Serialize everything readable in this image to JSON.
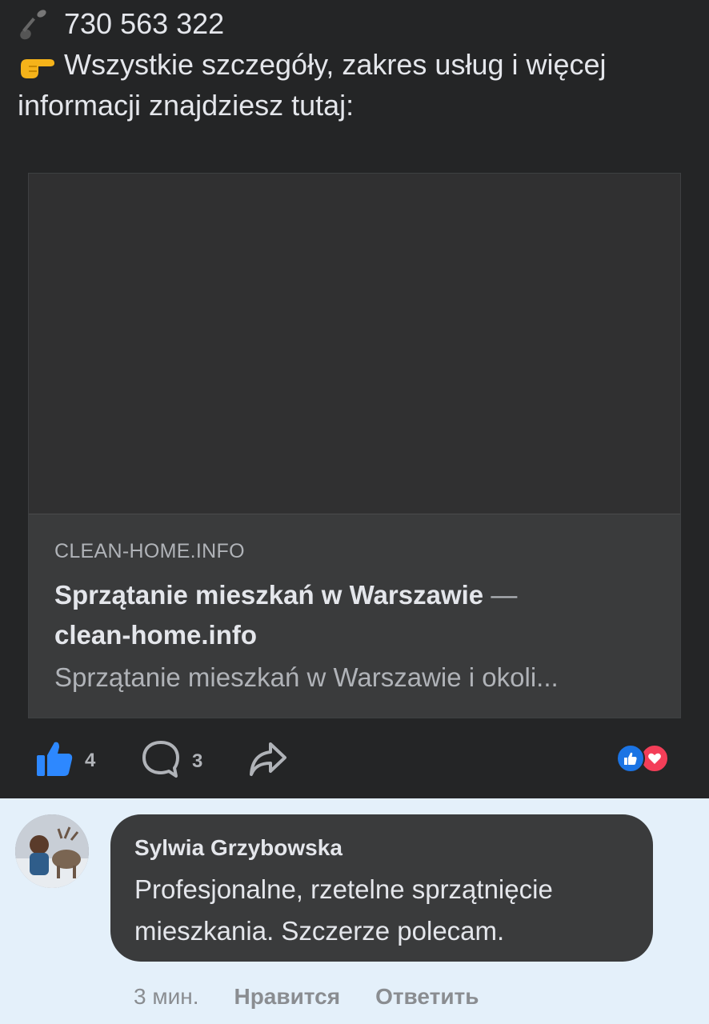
{
  "post": {
    "phone_icon": "telephone-receiver-icon",
    "phone": "730 563 322",
    "pointer_icon": "backhand-index-pointing-right-icon",
    "text_line1": "Wszystkie szczegóły, zakres usług i więcej",
    "text_line2": "informacji znajdziesz tutaj:"
  },
  "link_card": {
    "domain": "CLEAN-HOME.INFO",
    "title_part1": "Sprzątanie mieszkań w Warszawie",
    "title_dash": "—",
    "title_part2": "clean-home.info",
    "description": "Sprzątanie mieszkań w Warszawie i okoli..."
  },
  "actions": {
    "like_count": "4",
    "comment_count": "3",
    "reactions": [
      "like-icon",
      "heart-icon"
    ]
  },
  "comment": {
    "author": "Sylwia Grzybowska",
    "text_line1": "Profesjonalne, rzetelne sprzątnięcie",
    "text_line2": "mieszkania. Szczerze polecam.",
    "time": "3 мин.",
    "like_label": "Нравится",
    "reply_label": "Ответить"
  },
  "colors": {
    "background": "#242526",
    "card": "#3a3b3c",
    "accent_blue": "#1b74e4",
    "heart_red": "#f33e58",
    "comment_area": "#e4f0fa"
  }
}
